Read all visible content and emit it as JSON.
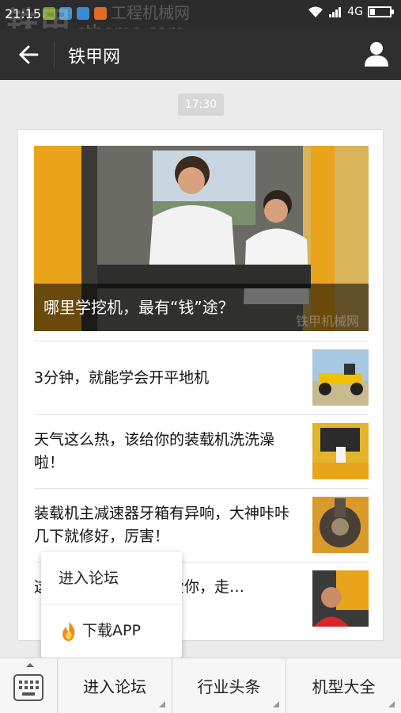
{
  "status": {
    "time": "21:15",
    "network": "4G"
  },
  "watermark": {
    "big": "铁甲",
    "small_cn": "工程机械网",
    "small_en": "cthome.com"
  },
  "header": {
    "title": "铁甲网"
  },
  "message_time": "17:30",
  "hero": {
    "caption": "哪里学挖机，最有“钱”途？",
    "watermark": "铁甲机械网"
  },
  "articles": [
    {
      "title": "3分钟，就能学会开平地机"
    },
    {
      "title": "天气这么热，该给你的装载机洗洗澡啦！"
    },
    {
      "title": "装载机主减速器牙箱有异响，大神咔咔几下就修好，厉害！"
    },
    {
      "title": "这位挖机司机…为了爱你，走…"
    }
  ],
  "popup": {
    "item1": "进入论坛",
    "item2": "下载APP"
  },
  "bottom_menu": [
    {
      "label": "进入论坛"
    },
    {
      "label": "行业头条"
    },
    {
      "label": "机型大全"
    }
  ],
  "colors": {
    "titlebar": "#2f2f2f",
    "statusbar": "#2c2c2c",
    "background": "#ebebeb",
    "excavator_yellow": "#e9a41c"
  }
}
